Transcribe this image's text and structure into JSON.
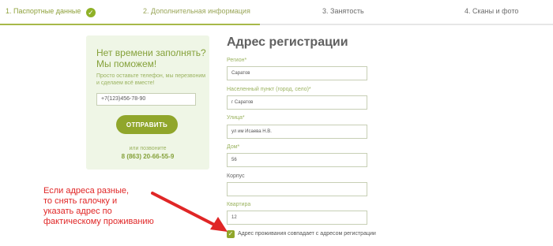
{
  "steps": [
    {
      "label": "1. Паспортные данные",
      "state": "done"
    },
    {
      "label": "2. Дополнительная информация",
      "state": "active"
    },
    {
      "label": "3. Занятость",
      "state": "pending"
    },
    {
      "label": "4. Сканы и фото",
      "state": "pending"
    }
  ],
  "progress": {
    "completed_fraction": 0.47
  },
  "icons": {
    "step_done": "check-circle-icon",
    "checkbox": "checkmark-icon"
  },
  "promo": {
    "title_line1": "Нет времени заполнять?",
    "title_line2": "Мы поможем!",
    "text": "Просто оставьте телефон, мы перезвоним и сделаем всё вместе!",
    "phone_value": "+7(123)456-78-90",
    "button_label": "ОТПРАВИТЬ",
    "call_text": "или позвоните",
    "call_phone": "8 (863) 20-66-55-9"
  },
  "form": {
    "title": "Адрес регистрации",
    "fields": {
      "region": {
        "label": "Регион*",
        "value": "Саратов"
      },
      "city": {
        "label": "Населенный пункт (город, село)*",
        "value": "г Саратов"
      },
      "street": {
        "label": "Улица*",
        "value": "ул им Исаева Н.В."
      },
      "house": {
        "label": "Дом*",
        "value": "56"
      },
      "building": {
        "label": "Корпус",
        "value": ""
      },
      "apartment": {
        "label": "Квартира",
        "value": "12"
      }
    },
    "same_address": {
      "checked": true,
      "label": "Адрес проживания совпадает с адресом регистрации"
    }
  },
  "annotation": {
    "line1": "Если адреса разные,",
    "line2": "то снять галочку и",
    "line3": "указать адрес по",
    "line4": "фактическому проживанию"
  },
  "colors": {
    "accent": "#90a62b",
    "promo_bg": "#eff6e6",
    "annotation_red": "#e02626"
  }
}
